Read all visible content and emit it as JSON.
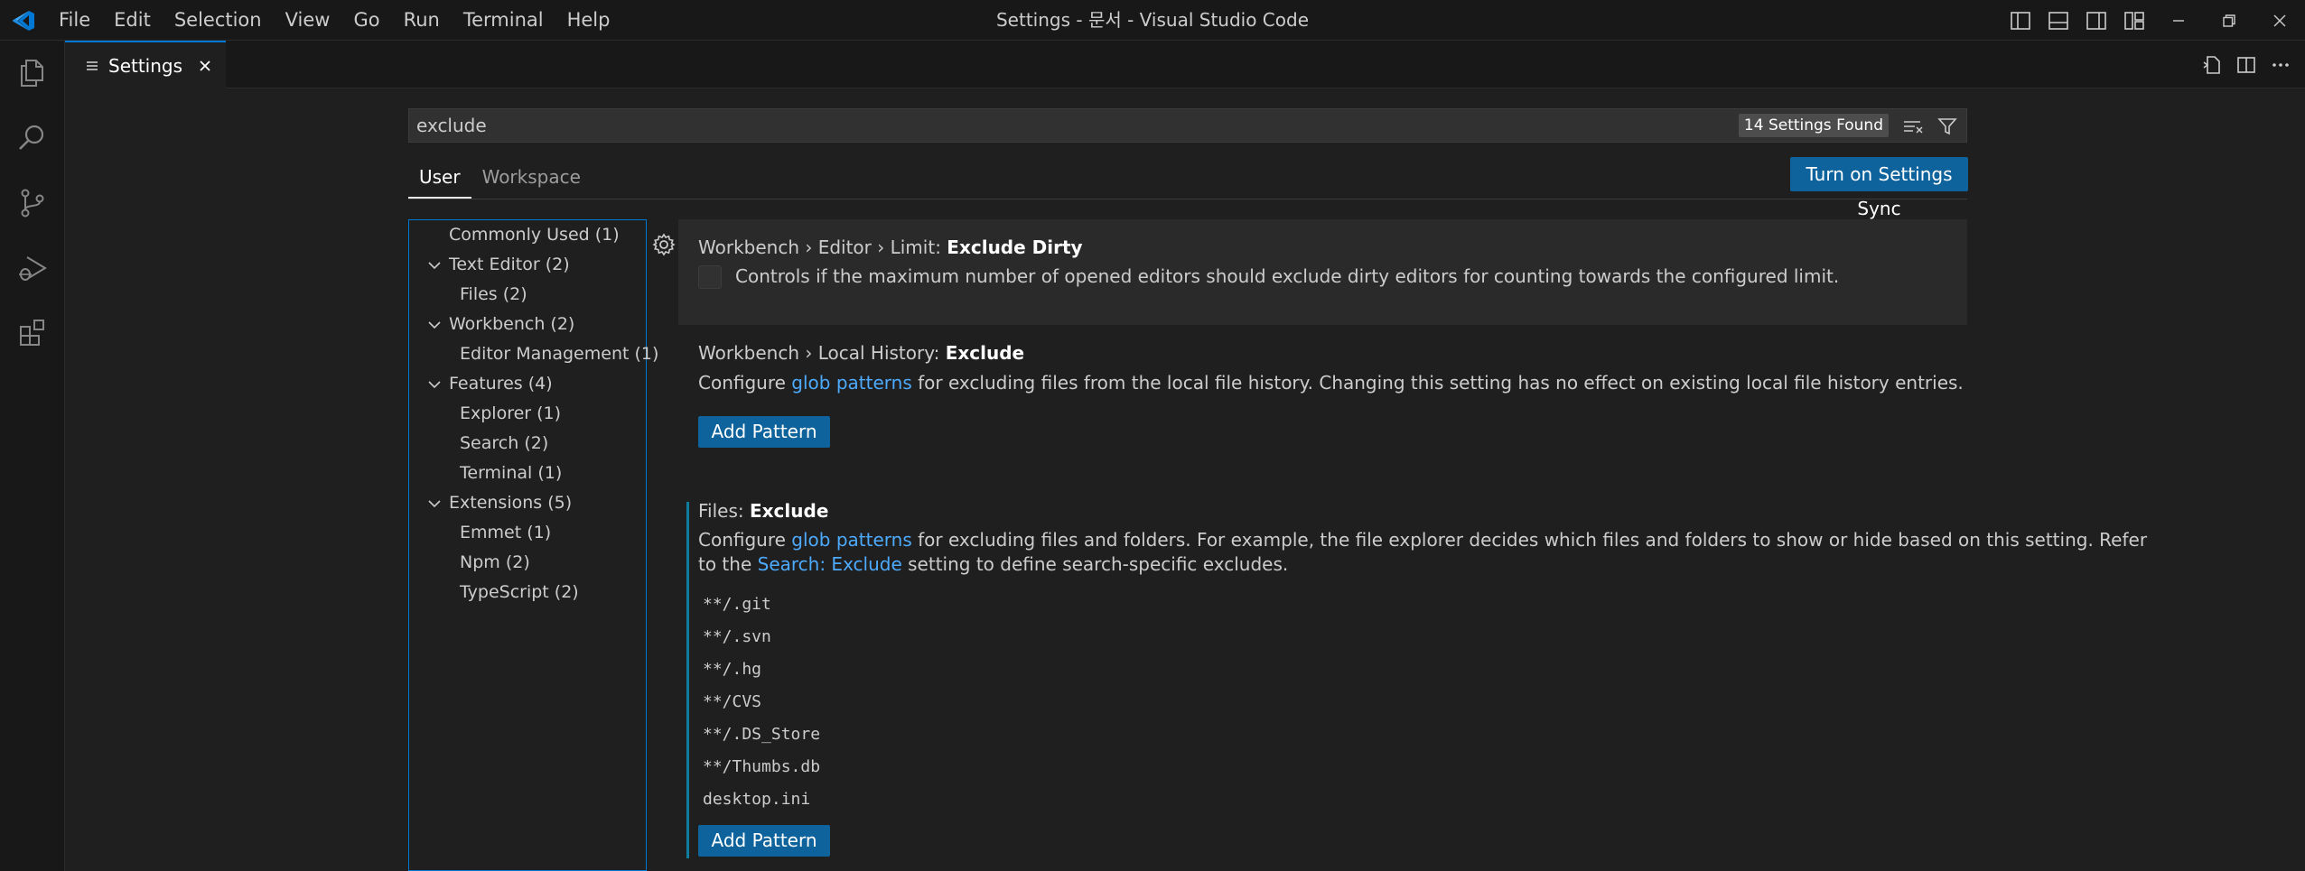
{
  "titlebar": {
    "menu": [
      "File",
      "Edit",
      "Selection",
      "View",
      "Go",
      "Run",
      "Terminal",
      "Help"
    ],
    "title": "Settings - 문서 - Visual Studio Code"
  },
  "activity_bar": [
    "explorer-icon",
    "search-icon",
    "source-control-icon",
    "run-debug-icon",
    "extensions-icon"
  ],
  "tab": {
    "label": "Settings"
  },
  "search": {
    "value": "exclude",
    "found": "14 Settings Found"
  },
  "scope_tabs": {
    "user": "User",
    "workspace": "Workspace"
  },
  "sync_button": "Turn on Settings Sync",
  "toc": [
    {
      "label": "Commonly Used (1)",
      "level": 0,
      "chevron": false
    },
    {
      "label": "Text Editor (2)",
      "level": 0,
      "chevron": true
    },
    {
      "label": "Files (2)",
      "level": 1,
      "chevron": false
    },
    {
      "label": "Workbench (2)",
      "level": 0,
      "chevron": true
    },
    {
      "label": "Editor Management (1)",
      "level": 1,
      "chevron": false
    },
    {
      "label": "Features (4)",
      "level": 0,
      "chevron": true
    },
    {
      "label": "Explorer (1)",
      "level": 1,
      "chevron": false
    },
    {
      "label": "Search (2)",
      "level": 1,
      "chevron": false
    },
    {
      "label": "Terminal (1)",
      "level": 1,
      "chevron": false
    },
    {
      "label": "Extensions (5)",
      "level": 0,
      "chevron": true
    },
    {
      "label": "Emmet (1)",
      "level": 1,
      "chevron": false
    },
    {
      "label": "Npm (2)",
      "level": 1,
      "chevron": false
    },
    {
      "label": "TypeScript (2)",
      "level": 1,
      "chevron": false
    }
  ],
  "settings": {
    "s1": {
      "category": "Workbench › Editor › Limit: ",
      "name": "Exclude Dirty",
      "desc": "Controls if the maximum number of opened editors should exclude dirty editors for counting towards the configured limit."
    },
    "s2": {
      "category": "Workbench › Local History: ",
      "name": "Exclude",
      "desc_pre": "Configure ",
      "desc_link": "glob patterns",
      "desc_post": " for excluding files from the local file history. Changing this setting has no effect on existing local file history entries.",
      "button": "Add Pattern"
    },
    "s3": {
      "category": "Files: ",
      "name": "Exclude",
      "desc1_pre": "Configure ",
      "desc1_link": "glob patterns",
      "desc1_post": " for excluding files and folders. For example, the file explorer decides which files and folders to show or hide based on this setting. Refer",
      "desc2_pre": "to the ",
      "desc2_link": "Search: Exclude",
      "desc2_post": " setting to define search-specific excludes.",
      "patterns": [
        "**/.git",
        "**/.svn",
        "**/.hg",
        "**/CVS",
        "**/.DS_Store",
        "**/Thumbs.db",
        "desktop.ini"
      ],
      "button": "Add Pattern"
    }
  },
  "colors": {
    "accent": "#0078d4",
    "button": "#0e639c",
    "link": "#4daafc",
    "modified": "#0c7d9d"
  }
}
